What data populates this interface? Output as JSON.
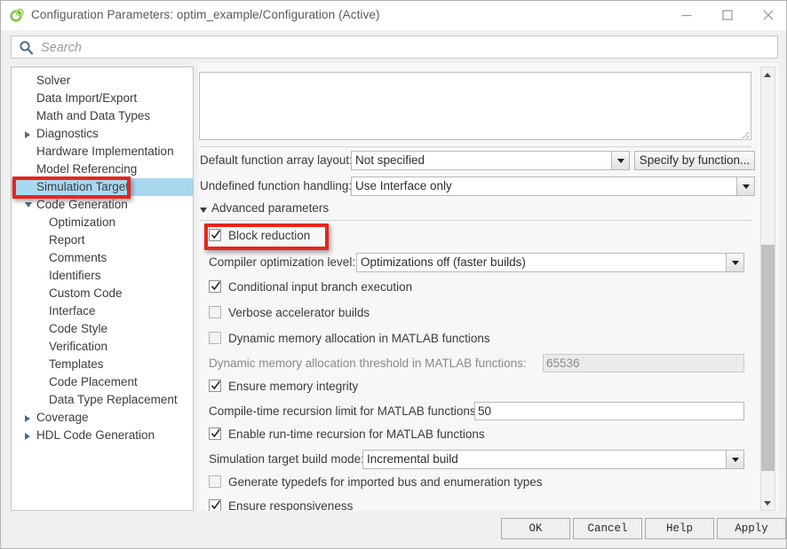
{
  "window": {
    "title": "Configuration Parameters: optim_example/Configuration (Active)",
    "icon": "simulink-icon",
    "minimize_label": "Minimize",
    "maximize_label": "Maximize",
    "close_label": "Close"
  },
  "search": {
    "placeholder": "Search",
    "value": "",
    "icon": "search-icon"
  },
  "tree": {
    "items": [
      {
        "label": "Solver",
        "indent": 28,
        "arrow": "none",
        "selected": false
      },
      {
        "label": "Data Import/Export",
        "indent": 28,
        "arrow": "none",
        "selected": false
      },
      {
        "label": "Math and Data Types",
        "indent": 28,
        "arrow": "none",
        "selected": false
      },
      {
        "label": "Diagnostics",
        "indent": 28,
        "arrow": "collapsed",
        "selected": false
      },
      {
        "label": "Hardware Implementation",
        "indent": 28,
        "arrow": "none",
        "selected": false
      },
      {
        "label": "Model Referencing",
        "indent": 28,
        "arrow": "none",
        "selected": false
      },
      {
        "label": "Simulation Target",
        "indent": 28,
        "arrow": "none",
        "selected": true
      },
      {
        "label": "Code Generation",
        "indent": 28,
        "arrow": "expanded",
        "selected": false
      },
      {
        "label": "Optimization",
        "indent": 42,
        "arrow": "none",
        "selected": false
      },
      {
        "label": "Report",
        "indent": 42,
        "arrow": "none",
        "selected": false
      },
      {
        "label": "Comments",
        "indent": 42,
        "arrow": "none",
        "selected": false
      },
      {
        "label": "Identifiers",
        "indent": 42,
        "arrow": "none",
        "selected": false
      },
      {
        "label": "Custom Code",
        "indent": 42,
        "arrow": "none",
        "selected": false
      },
      {
        "label": "Interface",
        "indent": 42,
        "arrow": "none",
        "selected": false
      },
      {
        "label": "Code Style",
        "indent": 42,
        "arrow": "none",
        "selected": false
      },
      {
        "label": "Verification",
        "indent": 42,
        "arrow": "none",
        "selected": false
      },
      {
        "label": "Templates",
        "indent": 42,
        "arrow": "none",
        "selected": false
      },
      {
        "label": "Code Placement",
        "indent": 42,
        "arrow": "none",
        "selected": false
      },
      {
        "label": "Data Type Replacement",
        "indent": 42,
        "arrow": "none",
        "selected": false
      },
      {
        "label": "Coverage",
        "indent": 28,
        "arrow": "collapsed",
        "selected": false
      },
      {
        "label": "HDL Code Generation",
        "indent": 28,
        "arrow": "collapsed",
        "selected": false
      }
    ]
  },
  "main": {
    "description_box": {
      "value": ""
    },
    "default_function_array_layout": {
      "label": "Default function array layout:",
      "value": "Not specified"
    },
    "specify_by_function_button": {
      "label": "Specify by function..."
    },
    "undefined_function_handling": {
      "label": "Undefined function handling:",
      "value": "Use Interface only"
    },
    "advanced_parameters": {
      "label": "Advanced parameters",
      "expanded": true
    },
    "block_reduction": {
      "label": "Block reduction",
      "checked": true
    },
    "compiler_optimization_level": {
      "label": "Compiler optimization level:",
      "value": "Optimizations off (faster builds)"
    },
    "conditional_input_branch_execution": {
      "label": "Conditional input branch execution",
      "checked": true
    },
    "verbose_accelerator_builds": {
      "label": "Verbose accelerator builds",
      "checked": false
    },
    "dynamic_memory_allocation": {
      "label": "Dynamic memory allocation in MATLAB functions",
      "checked": false
    },
    "dynamic_memory_threshold": {
      "label": "Dynamic memory allocation threshold in MATLAB functions:",
      "value": "65536",
      "disabled": true
    },
    "ensure_memory_integrity": {
      "label": "Ensure memory integrity",
      "checked": true
    },
    "compile_time_recursion_limit": {
      "label": "Compile-time recursion limit for MATLAB functions:",
      "value": "50"
    },
    "enable_runtime_recursion": {
      "label": "Enable run-time recursion for MATLAB functions",
      "checked": true
    },
    "simulation_target_build_mode": {
      "label": "Simulation target build mode:",
      "value": "Incremental build"
    },
    "generate_typedefs": {
      "label": "Generate typedefs for imported bus and enumeration types",
      "checked": false
    },
    "ensure_responsiveness": {
      "label": "Ensure responsiveness",
      "checked": true
    }
  },
  "footer": {
    "ok": "OK",
    "cancel": "Cancel",
    "help": "Help",
    "apply": "Apply"
  },
  "colors": {
    "annotation": "#e8241c",
    "selection": "#a8d8f0"
  }
}
